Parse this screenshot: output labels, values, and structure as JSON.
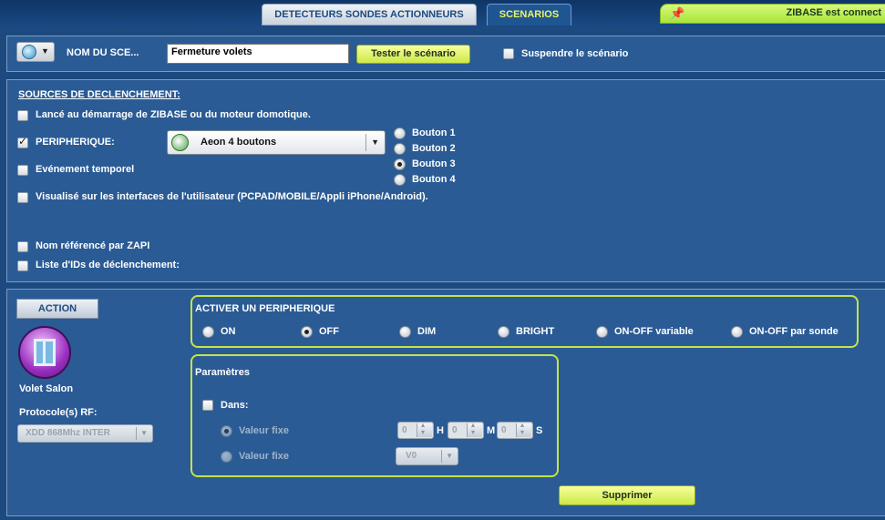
{
  "tabs": {
    "detecteurs": "DETECTEURS SONDES ACTIONNEURS",
    "scenarios": "SCENARIOS"
  },
  "status": {
    "text": "ZIBASE est connect"
  },
  "scenario": {
    "name_label": "NOM DU SCE...",
    "name_value": "Fermeture volets",
    "test_button": "Tester le scénario",
    "suspend_label": "Suspendre le scénario"
  },
  "triggers": {
    "title": "SOURCES DE DECLENCHEMENT:",
    "startup": "Lancé au démarrage de ZIBASE ou du moteur domotique.",
    "peripherique": "PERIPHERIQUE:",
    "device": "Aeon 4 boutons",
    "temporal": "Evénement temporel",
    "visualized": "Visualisé sur les interfaces de l'utilisateur (PCPAD/MOBILE/Appli iPhone/Android).",
    "zapi": "Nom référencé par ZAPI",
    "ids": "Liste d'IDs de déclenchement:",
    "buttons": [
      "Bouton 1",
      "Bouton 2",
      "Bouton 3",
      "Bouton 4"
    ],
    "selected_button": "Bouton 3"
  },
  "action": {
    "button": "ACTION",
    "device_name": "Volet Salon",
    "protocol_label": "Protocole(s) RF:",
    "protocol_value": "XDD 868Mhz INTER",
    "activate_title": "ACTIVER UN PERIPHERIQUE",
    "options": [
      "ON",
      "OFF",
      "DIM",
      "BRIGHT",
      "ON-OFF variable",
      "ON-OFF par sonde"
    ],
    "selected_option": "OFF",
    "params_title": "Paramètres",
    "dans": "Dans:",
    "valeur_fixe_1": "Valeur fixe",
    "valeur_fixe_2": "Valeur fixe",
    "h_value": "0",
    "h_label": "H",
    "m_value": "0",
    "m_label": "M",
    "s_value": "0",
    "s_label": "S",
    "v_select": "V0",
    "delete_button": "Supprimer"
  }
}
